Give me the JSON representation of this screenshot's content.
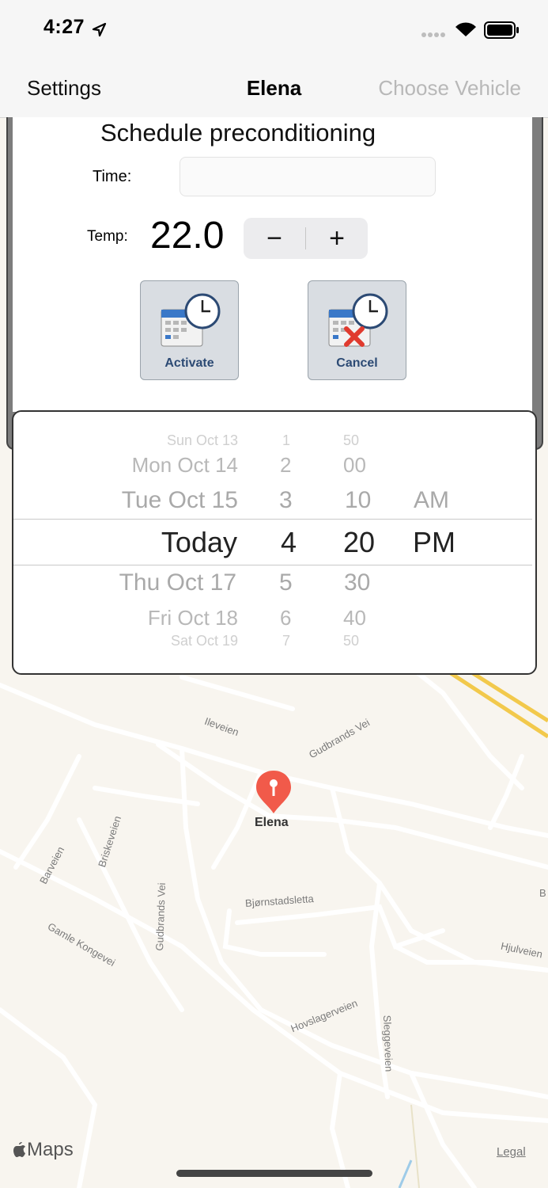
{
  "status": {
    "time": "4:27"
  },
  "nav": {
    "left": "Settings",
    "title": "Elena",
    "right": "Choose Vehicle"
  },
  "panel": {
    "title": "Schedule preconditioning",
    "time_label": "Time:",
    "time_value": "",
    "temp_label": "Temp:",
    "temp_value": "22.0",
    "minus": "−",
    "plus": "+",
    "activate_label": "Activate",
    "cancel_label": "Cancel"
  },
  "picker": {
    "days": [
      "Sun Oct 13",
      "Mon Oct 14",
      "Tue Oct 15",
      "Today",
      "Thu Oct 17",
      "Fri Oct 18",
      "Sat Oct 19"
    ],
    "hours": [
      "1",
      "2",
      "3",
      "4",
      "5",
      "6",
      "7"
    ],
    "minutes": [
      "50",
      "00",
      "10",
      "20",
      "30",
      "40",
      "50"
    ],
    "ampm": [
      "AM",
      "PM"
    ]
  },
  "map": {
    "pin_label": "Elena",
    "streets": [
      "Ileveien",
      "Gudbrands Vei",
      "Briskeveien",
      "Barveien",
      "Gudbrands Vei",
      "Bjørnstadsletta",
      "Gamle Kongevei",
      "Hjulveien",
      "Hovslagerveien",
      "Sleggeveien",
      "B"
    ],
    "maps_label": "Maps",
    "legal": "Legal"
  }
}
